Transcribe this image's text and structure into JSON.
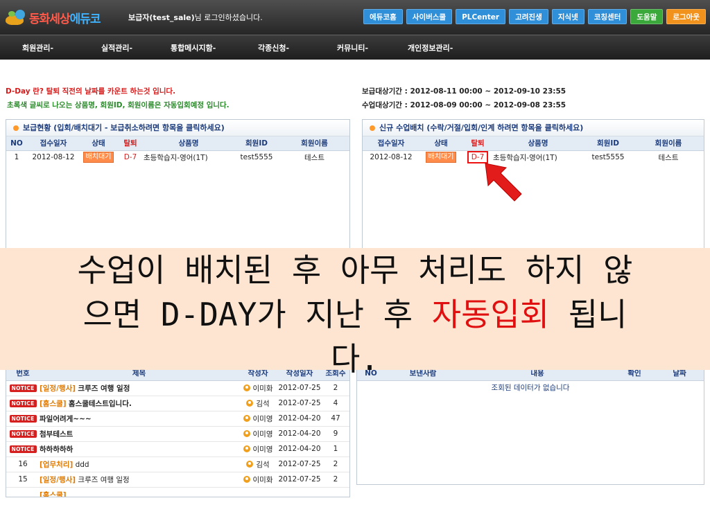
{
  "header": {
    "logo_text_a": "동화세상",
    "logo_text_b": "에듀",
    "logo_text_c": "코",
    "login_name": "보급자(test_sale)",
    "login_suffix": "님 로그인하셨습니다.",
    "nav": [
      {
        "label": "에듀코홈",
        "color": "#2f8fd8"
      },
      {
        "label": "사이버스쿨",
        "color": "#2f8fd8"
      },
      {
        "label": "PLCenter",
        "color": "#2f8fd8"
      },
      {
        "label": "고려진생",
        "color": "#2f8fd8"
      },
      {
        "label": "지식넷",
        "color": "#2f8fd8"
      },
      {
        "label": "코칭센터",
        "color": "#2f8fd8"
      },
      {
        "label": "도움말",
        "color": "#3aa83a"
      },
      {
        "label": "로그아웃",
        "color": "#f0921c"
      }
    ]
  },
  "menu": [
    "회원관리-",
    "실적관리-",
    "통합메시지함-",
    "각종신청-",
    "커뮤니티-",
    "개인정보관리-"
  ],
  "notices": {
    "left_line1": "D-Day 란? 탈퇴 직전의 날짜를 카운트 하는것 입니다.",
    "left_line2": "초록색 글씨로 나오는 상품명, 회원ID, 회원이름은 자동입회예정 입니다.",
    "right_line1": "보급대상기간 : 2012-08-11 00:00 ~ 2012-09-10 23:55",
    "right_line2": "수업대상기간 : 2012-08-09 00:00 ~ 2012-09-08 23:55"
  },
  "left_panel": {
    "title": "보급현황 (입회/배치대기 - 보급취소하려면 항목을 클릭하세요)",
    "headers": [
      "NO",
      "접수일자",
      "상태",
      "탈퇴",
      "상품명",
      "회원ID",
      "회원이름"
    ],
    "rows": [
      {
        "no": "1",
        "date": "2012-08-12",
        "status": "배치대기",
        "dday": "D-7",
        "product": "초등학습지-영어(1T)",
        "id": "test5555",
        "name": "테스트"
      }
    ]
  },
  "right_panel": {
    "title": "신규 수업배치 (수락/거절/입회/인계 하려면 항목을 클릭하세요)",
    "headers": [
      "접수일자",
      "상태",
      "탈퇴",
      "상품명",
      "회원ID",
      "회원이름"
    ],
    "rows": [
      {
        "date": "2012-08-12",
        "status": "배치대기",
        "dday": "D-7",
        "product": "초등학습지-영어(1T)",
        "id": "test5555",
        "name": "테스트"
      }
    ]
  },
  "board": {
    "headers": [
      "번호",
      "제목",
      "작성자",
      "작성일자",
      "조회수"
    ],
    "notice_label": "NOTICE",
    "rows": [
      {
        "no": "NOTICE",
        "cat": "[일정/행사]",
        "title": "크루즈 여행 일정",
        "author": "이미화",
        "date": "2012-07-25",
        "views": "2"
      },
      {
        "no": "NOTICE",
        "cat": "[홈스쿨]",
        "title": "홈스쿨테스트입니다.",
        "author": "김석",
        "date": "2012-07-25",
        "views": "4"
      },
      {
        "no": "NOTICE",
        "cat": "",
        "title": "파일어려게~~~",
        "author": "이미영",
        "date": "2012-04-20",
        "views": "47"
      },
      {
        "no": "NOTICE",
        "cat": "",
        "title": "첨부테스트",
        "author": "이미영",
        "date": "2012-04-20",
        "views": "9"
      },
      {
        "no": "NOTICE",
        "cat": "",
        "title": "하하하하하",
        "author": "이미영",
        "date": "2012-04-20",
        "views": "1"
      },
      {
        "no": "16",
        "cat": "[업무처리]",
        "title": "ddd",
        "author": "김석",
        "date": "2012-07-25",
        "views": "2"
      },
      {
        "no": "15",
        "cat": "[일정/행사]",
        "title": "크루즈 여행 일정",
        "author": "이미화",
        "date": "2012-07-25",
        "views": "2"
      },
      {
        "no": "",
        "cat": "[홈스쿨]",
        "title": "",
        "author": "",
        "date": "",
        "views": ""
      }
    ]
  },
  "messages": {
    "headers": [
      "NO",
      "보낸사람",
      "내용",
      "확인",
      "날짜"
    ],
    "empty": "조회된 데이터가 없습니다"
  },
  "overlay": {
    "line1": "수업이 배치된 후 아무 처리도 하지 않",
    "line2_a": "으면 D-DAY가 지난 후 ",
    "line2_b": "자동입회",
    "line2_c": " 됩니",
    "line3": "다."
  }
}
